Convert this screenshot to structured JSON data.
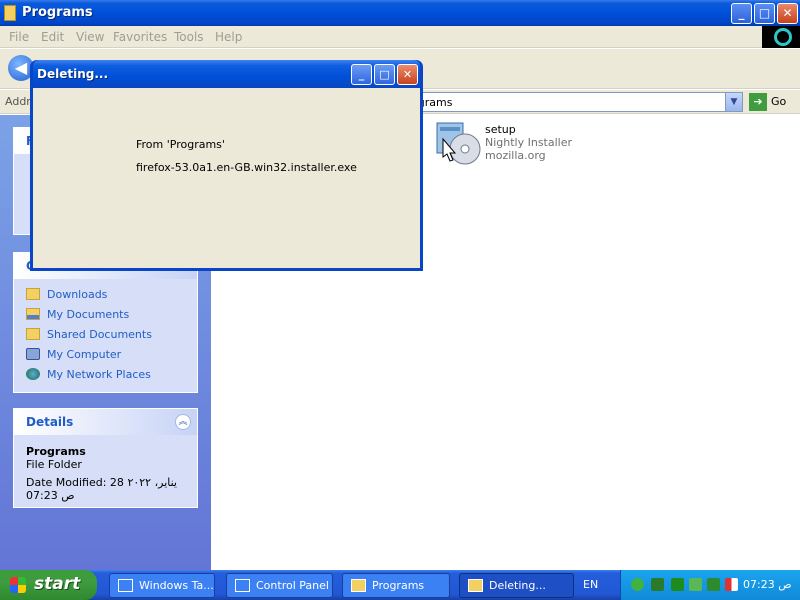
{
  "window": {
    "title": "Programs",
    "menu": [
      "File",
      "Edit",
      "View",
      "Favorites",
      "Tools",
      "Help"
    ],
    "buttons": {
      "minimize": "_",
      "maximize": "□",
      "close": "✕"
    }
  },
  "toolbar": {
    "back_icon": "back-arrow-icon",
    "back_glyph": "◀"
  },
  "address": {
    "label": "Addr",
    "value": "ograms",
    "dropdown_glyph": "▼",
    "go_label": "Go",
    "go_glyph": "➔"
  },
  "task_pane": {
    "first_box_header": "F",
    "other_box_header": "O",
    "other_places": [
      "Downloads",
      "My Documents",
      "Shared Documents",
      "My Computer",
      "My Network Places"
    ],
    "details": {
      "header": "Details",
      "collapse_glyph": "︽",
      "name": "Programs",
      "type": "File Folder",
      "modified_line1": "Date Modified: 28 يناير، ٢٠٢٢",
      "modified_line2": "07:23 ص"
    }
  },
  "content": {
    "item": {
      "name": "setup",
      "description": "Nightly Installer",
      "company": "mozilla.org"
    }
  },
  "dialog": {
    "title": "Deleting...",
    "from_text": "From 'Programs'",
    "file_text": "firefox-53.0a1.en-GB.win32.installer.exe",
    "buttons": {
      "minimize": "_",
      "maximize": "□",
      "close": "✕"
    }
  },
  "taskbar": {
    "start_label": "start",
    "tasks": [
      {
        "label": "Windows Ta...",
        "active": false
      },
      {
        "label": "Control Panel",
        "active": false
      },
      {
        "label": "Programs",
        "active": false
      },
      {
        "label": "Deleting...",
        "active": true
      }
    ],
    "language": "EN",
    "clock": "07:23 ص"
  },
  "colors": {
    "xp_blue": "#0050d8",
    "pane_blue": "#6375d6",
    "link_blue": "#215dc6",
    "dialog_bg": "#ece9d8",
    "start_green": "#3f9c3f"
  }
}
